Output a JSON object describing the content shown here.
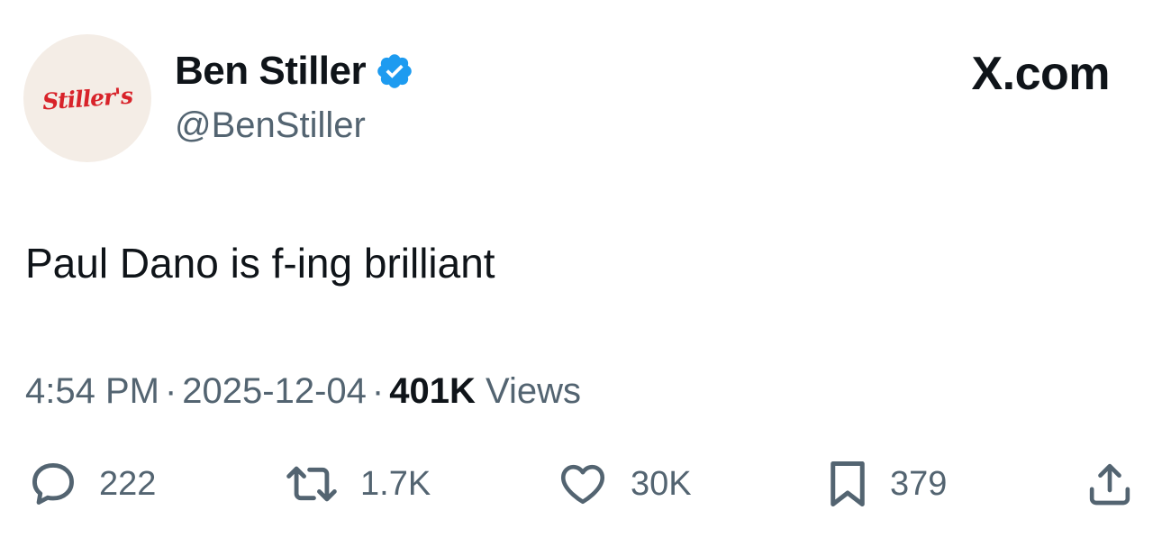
{
  "author": {
    "display_name": "Ben Stiller",
    "handle": "@BenStiller",
    "avatar_text": "Stiller's",
    "verified": true
  },
  "site": {
    "label": "X.com"
  },
  "tweet": {
    "text": "Paul Dano is f-ing brilliant",
    "time": "4:54 PM",
    "date": "2025-12-04",
    "views_count": "401K",
    "views_label": "Views",
    "separator": "·"
  },
  "actions": {
    "replies": "222",
    "reposts": "1.7K",
    "likes": "30K",
    "bookmarks": "379"
  },
  "icons": {
    "reply": "speech-bubble-icon",
    "repost": "repost-arrows-icon",
    "like": "heart-icon",
    "bookmark": "bookmark-icon",
    "share": "share-upload-icon",
    "verified": "verified-badge-icon"
  },
  "colors": {
    "verified_blue": "#1d9bf0",
    "text_primary": "#0f1419",
    "text_secondary": "#536471",
    "avatar_bg": "#f4ede6",
    "avatar_logo_red": "#d8232a"
  }
}
